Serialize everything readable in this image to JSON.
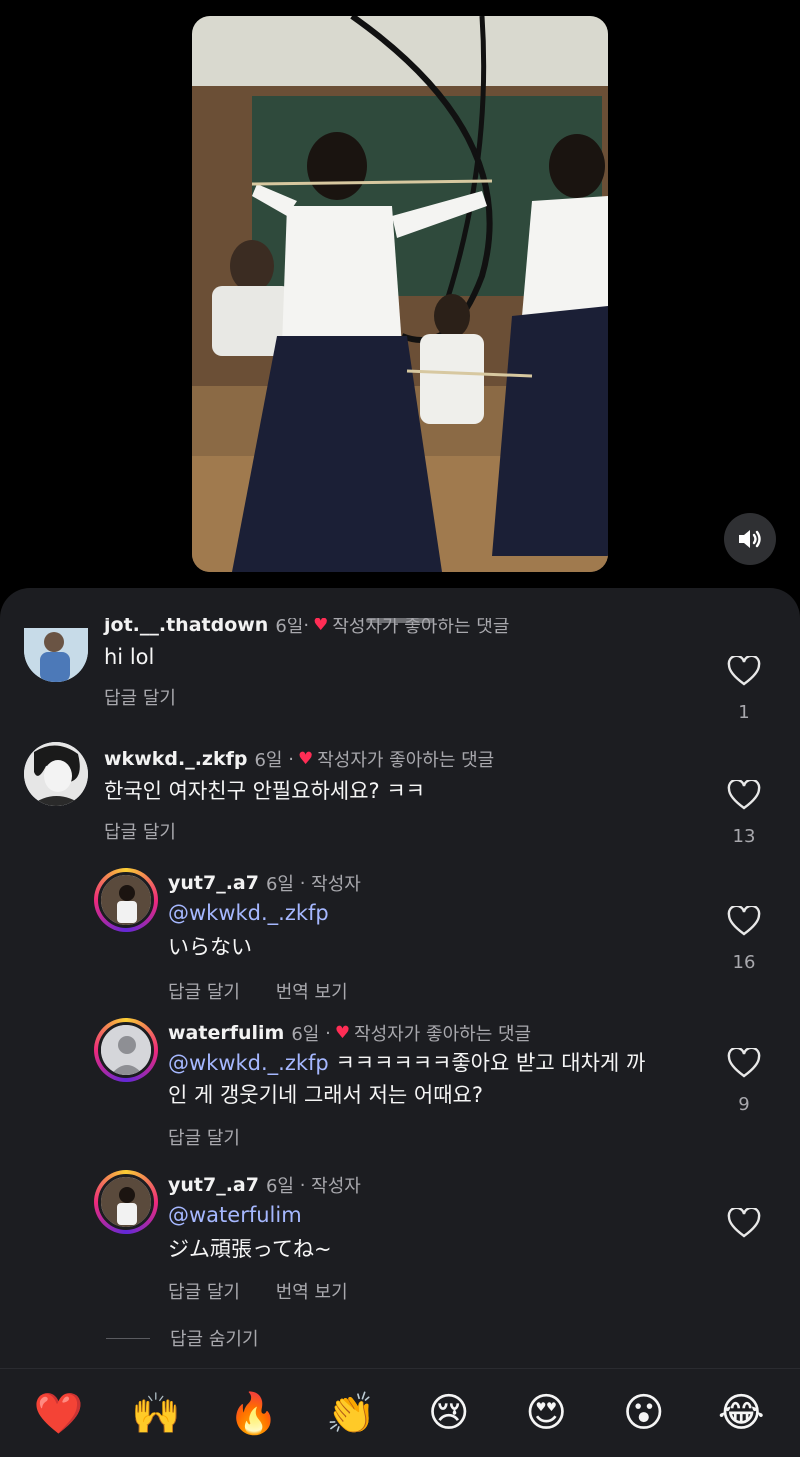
{
  "video": {
    "sound_icon": "speaker-icon"
  },
  "comments": [
    {
      "username": "jot.__.thatdown",
      "time": "6일",
      "author_liked": "작성자가 좋아하는 댓글",
      "text": "hi lol",
      "reply": "답글 달기",
      "likes": "1"
    },
    {
      "username": "wkwkd._.zkfp",
      "time": "6일",
      "author_liked": "작성자가 좋아하는 댓글",
      "text": "한국인 여자친구 안필요하세요? ㅋㅋ",
      "reply": "답글 달기",
      "likes": "13"
    }
  ],
  "replies": [
    {
      "username": "yut7_.a7",
      "time": "6일",
      "tag": "작성자",
      "mention": "@wkwkd._.zkfp",
      "text": "いらない",
      "reply": "답글 달기",
      "translate": "번역 보기",
      "likes": "16"
    },
    {
      "username": "waterfulim",
      "time": "6일",
      "author_liked": "작성자가 좋아하는 댓글",
      "mention": "@wkwkd._.zkfp",
      "text_line1": " ㅋㅋㅋㅋㅋㅋ좋아요 받고 대차게 까",
      "text_line2": "인 게 갱웃기네 그래서 저는 어때요?",
      "reply": "답글 달기",
      "likes": "9"
    },
    {
      "username": "yut7_.a7",
      "time": "6일",
      "tag": "작성자",
      "mention": "@waterfulim",
      "text": "ジム頑張ってね~",
      "reply": "답글 달기",
      "translate": "번역 보기",
      "likes": ""
    }
  ],
  "hide_replies": "답글 숨기기",
  "reactions": [
    "❤️",
    "🙌",
    "🔥",
    "👏",
    "😢",
    "😍",
    "😮",
    "😂"
  ],
  "colors": {
    "sheet_bg": "#1c1d21",
    "mention": "#a6b8ff",
    "heart": "#ff2d55"
  }
}
